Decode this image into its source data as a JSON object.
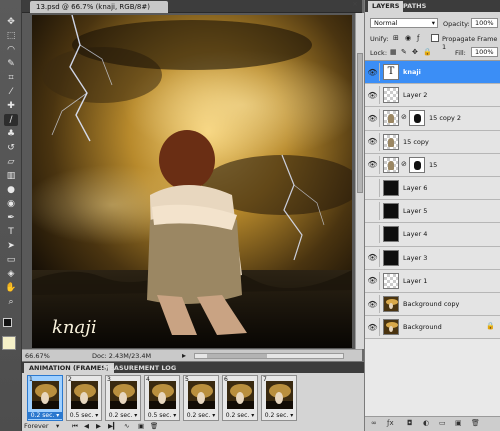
{
  "document": {
    "tab_title": "13.psd @ 66.7% (knaji, RGB/8#)",
    "close_glyph": "×",
    "watermark_text": "knaji"
  },
  "status": {
    "zoom": "66.67%",
    "doc_size": "Doc: 2.43M/23.4M"
  },
  "tools": [
    "move-tool",
    "marquee-tool",
    "lasso-tool",
    "quick-select-tool",
    "crop-tool",
    "eyedropper-tool",
    "healing-tool",
    "brush-tool",
    "clone-stamp-tool",
    "history-brush-tool",
    "eraser-tool",
    "gradient-tool",
    "blur-tool",
    "dodge-tool",
    "pen-tool",
    "type-tool",
    "path-select-tool",
    "shape-tool",
    "3d-tool",
    "hand-tool",
    "zoom-tool"
  ],
  "colors": {
    "panel_bg": "#d6d6d6",
    "selection": "#3b8ef6",
    "foreground_swatch": "#111111",
    "background_swatch": "#f5f0c8"
  },
  "animation_panel": {
    "tabs": [
      {
        "label": "ANIMATION (FRAMES)"
      },
      {
        "label": "MEASUREMENT LOG"
      }
    ],
    "frames": [
      {
        "num": "1",
        "delay": "0.2 sec.",
        "selected": true
      },
      {
        "num": "2",
        "delay": "0.5 sec."
      },
      {
        "num": "3",
        "delay": "0.2 sec."
      },
      {
        "num": "4",
        "delay": "0.5 sec."
      },
      {
        "num": "5",
        "delay": "0.2 sec."
      },
      {
        "num": "6",
        "delay": "0.2 sec."
      },
      {
        "num": "7",
        "delay": "0.2 sec."
      }
    ],
    "loop_label": "Forever"
  },
  "layers_panel": {
    "tabs": [
      {
        "label": "LAYERS"
      },
      {
        "label": "PATHS"
      }
    ],
    "blend_mode": "Normal",
    "opacity_label": "Opacity:",
    "opacity_value": "100%",
    "unify_label": "Unify:",
    "propagate_label": "Propagate Frame 1",
    "lock_label": "Lock:",
    "fill_label": "Fill:",
    "fill_value": "100%",
    "layers": [
      {
        "name": "knaji",
        "thumb": "type",
        "visible": true,
        "selected": true
      },
      {
        "name": "Layer 2",
        "thumb": "transparent",
        "visible": true
      },
      {
        "name": "15 copy 2",
        "thumb": "person-mask",
        "visible": true
      },
      {
        "name": "15 copy",
        "thumb": "person",
        "visible": true
      },
      {
        "name": "15",
        "thumb": "person-mask",
        "visible": true
      },
      {
        "name": "Layer 6",
        "thumb": "dark",
        "visible": false
      },
      {
        "name": "Layer 5",
        "thumb": "dark",
        "visible": false
      },
      {
        "name": "Layer 4",
        "thumb": "dark",
        "visible": false
      },
      {
        "name": "Layer 3",
        "thumb": "dark",
        "visible": true
      },
      {
        "name": "Layer 1",
        "thumb": "transparent",
        "visible": true
      },
      {
        "name": "Background copy",
        "thumb": "photo",
        "visible": true
      },
      {
        "name": "Background",
        "thumb": "photo",
        "visible": true,
        "locked": true
      }
    ]
  }
}
